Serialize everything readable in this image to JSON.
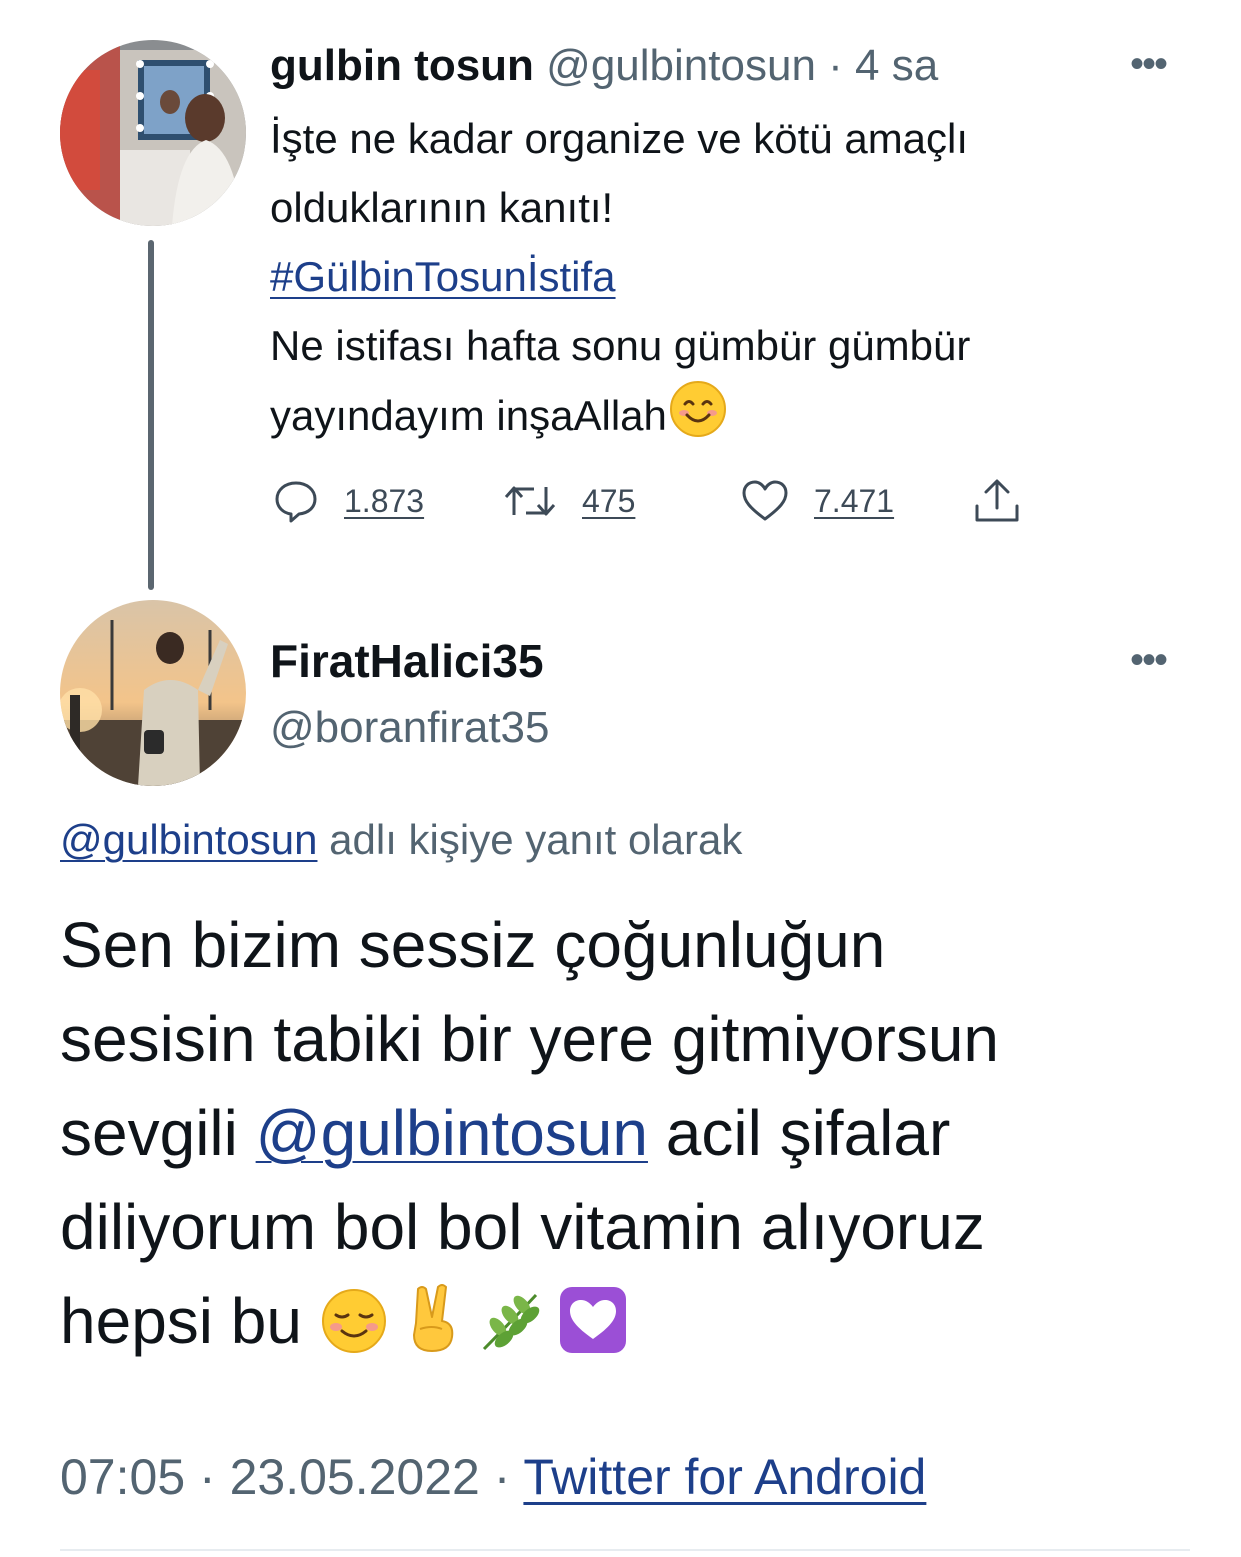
{
  "parent_tweet": {
    "display_name": "gulbin tosun",
    "handle": "@gulbintosun",
    "separator": "·",
    "time_ago": "4 sa",
    "more_label": "•••",
    "text_lines": [
      "İşte ne kadar organize ve kötü amaçlı",
      "olduklarının kanıtı!"
    ],
    "hashtag": "#GülbinTosunİstifa",
    "text_lines_after": [
      "Ne istifası hafta sonu gümbür gümbür"
    ],
    "last_line": "yayındayım inşaAllah",
    "emoji": "smiling-face-with-smiling-eyes",
    "replies": "1.873",
    "retweets": "475",
    "likes": "7.471"
  },
  "reply_tweet": {
    "display_name": "FiratHalici35",
    "handle": "@boranfirat35",
    "more_label": "•••",
    "replying_to_mention": "@gulbintosun",
    "replying_to_suffix": " adlı kişiye yanıt olarak",
    "line1": "Sen bizim sessiz çoğunluğun",
    "line2": "sesisin tabiki bir yere gitmiyorsun",
    "line3_prefix": "sevgili ",
    "line3_mention": "@gulbintosun",
    "line3_suffix": " acil şifalar",
    "line4": "diliyorum bol bol vitamin alıyoruz",
    "line5": "hepsi bu ",
    "emojis": [
      "smiling-face",
      "victory-hand",
      "herb",
      "heart-decoration"
    ],
    "time": "07:05",
    "date": "23.05.2022",
    "separator": "·",
    "source": "Twitter for Android"
  },
  "colors": {
    "text": "#0f1419",
    "secondary": "#536471",
    "link": "#1d3f8a",
    "thread_line": "#5b6670"
  }
}
